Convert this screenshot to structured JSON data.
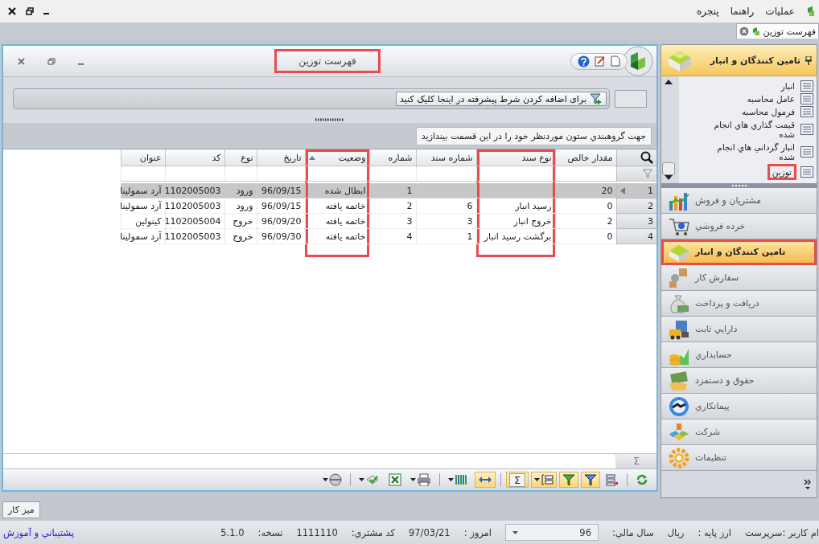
{
  "menu_bar": {
    "items": [
      "عملیات",
      "راهنما",
      "پنجره"
    ]
  },
  "tabs": [
    {
      "label": "فهرست توزین",
      "selected": true
    }
  ],
  "document": {
    "title": "فهرست توزین",
    "title_highlighted": true,
    "filter_prompt": "برای اضافه کردن شرط پیشرفته در اینجا کلیک کنید",
    "group_hint": "جهت گروهبندي ستون موردنظر خود را در این قسمت بيندازيد",
    "table": {
      "columns": [
        {
          "label": "مقدار خالص",
          "highlighted": false,
          "sorted": false
        },
        {
          "label": "نوع سند",
          "highlighted": true,
          "sorted": false
        },
        {
          "label": "شماره سند",
          "highlighted": false,
          "sorted": false
        },
        {
          "label": "شماره",
          "highlighted": false,
          "sorted": false
        },
        {
          "label": "وضعیت",
          "highlighted": true,
          "sorted": true
        },
        {
          "label": "تاریخ",
          "highlighted": false,
          "sorted": false
        },
        {
          "label": "نوع",
          "highlighted": false,
          "sorted": false
        },
        {
          "label": "کد",
          "highlighted": false,
          "sorted": false
        },
        {
          "label": "عنوان",
          "highlighted": false,
          "sorted": false
        }
      ],
      "rows": [
        {
          "number": "1",
          "selected": true,
          "cells": [
            "20",
            "",
            "",
            "1",
            "ابطال شده",
            "96/09/15",
            "ورود",
            "1102005003",
            "آرد سمولينا"
          ]
        },
        {
          "number": "2",
          "selected": false,
          "cells": [
            "0",
            "رسید انبار",
            "6",
            "2",
            "خاتمه یافته",
            "96/09/15",
            "ورود",
            "1102005003",
            "آرد سمولينا"
          ]
        },
        {
          "number": "3",
          "selected": false,
          "cells": [
            "2",
            "خروج انبار",
            "3",
            "3",
            "خاتمه یافته",
            "96/09/20",
            "خروج",
            "1102005004",
            "کینولین"
          ]
        },
        {
          "number": "4",
          "selected": false,
          "cells": [
            "0",
            "برگشت رسید انبار",
            "1",
            "4",
            "خاتمه یافته",
            "96/09/30",
            "خروج",
            "1102005003",
            "آرد سمولينا"
          ]
        }
      ]
    },
    "summary_symbol": "Σ",
    "toolbar": [
      {
        "kind": "refresh",
        "on": false,
        "dropdown": false
      },
      {
        "kind": "separator"
      },
      {
        "kind": "column-chooser",
        "on": false,
        "dropdown": false
      },
      {
        "kind": "filter",
        "on": true,
        "dropdown": false
      },
      {
        "kind": "filter-green",
        "on": true,
        "dropdown": false
      },
      {
        "kind": "group",
        "on": true,
        "dropdown": true
      },
      {
        "kind": "sum",
        "on": true,
        "dropdown": false,
        "label": "Σ"
      },
      {
        "kind": "separator"
      },
      {
        "kind": "fit",
        "on": true,
        "dropdown": false
      },
      {
        "kind": "bars",
        "on": false,
        "dropdown": true
      },
      {
        "kind": "separator"
      },
      {
        "kind": "print",
        "on": false,
        "dropdown": true
      },
      {
        "kind": "excel",
        "on": false,
        "dropdown": false
      },
      {
        "kind": "export",
        "on": false,
        "dropdown": true
      },
      {
        "kind": "separator"
      },
      {
        "kind": "globe",
        "on": false,
        "dropdown": true
      }
    ]
  },
  "navigation": {
    "header": "تامین کنندگان و انبار",
    "items": [
      {
        "label": "انبار",
        "selected": false,
        "highlighted": false
      },
      {
        "label": "عامل محاسبه",
        "selected": false,
        "highlighted": false
      },
      {
        "label": "فرمول محاسبه",
        "selected": false,
        "highlighted": false
      },
      {
        "label": "قیمت گذاري هاي انجام شده",
        "selected": false,
        "highlighted": false
      },
      {
        "label": "انبار گرداني هاي انجام شده",
        "selected": false,
        "highlighted": false
      },
      {
        "label": "توزین",
        "selected": false,
        "highlighted": true
      }
    ],
    "modules": [
      {
        "label": "مشتريان و فروش",
        "selected": false,
        "highlighted": false
      },
      {
        "label": "خرده فروشي",
        "selected": false,
        "highlighted": false
      },
      {
        "label": "تامین کنندگان و انبار",
        "selected": true,
        "highlighted": true
      },
      {
        "label": "سفارش کار",
        "selected": false,
        "highlighted": false
      },
      {
        "label": "دریافت و پرداخت",
        "selected": false,
        "highlighted": false
      },
      {
        "label": "دارايي ثابت",
        "selected": false,
        "highlighted": false
      },
      {
        "label": "حسابداري",
        "selected": false,
        "highlighted": false
      },
      {
        "label": "حقوق و دستمزد",
        "selected": false,
        "highlighted": false
      },
      {
        "label": "پيمانكاري",
        "selected": false,
        "highlighted": false
      },
      {
        "label": "شرکت",
        "selected": false,
        "highlighted": false
      },
      {
        "label": "تنظیمات",
        "selected": false,
        "highlighted": false
      }
    ]
  },
  "desk_button": "میز کار",
  "status_bar": [
    {
      "kind": "label",
      "text": "ام کاربر :سرپرست"
    },
    {
      "kind": "label",
      "text": "ارز پایه :"
    },
    {
      "kind": "value",
      "text": "ريال"
    },
    {
      "kind": "label",
      "text": "سال مالي:"
    },
    {
      "kind": "field",
      "text": "96"
    },
    {
      "kind": "label",
      "text": "امروز :"
    },
    {
      "kind": "value",
      "text": "97/03/21"
    },
    {
      "kind": "label",
      "text": "کد مشتري:"
    },
    {
      "kind": "value",
      "text": "1111110"
    },
    {
      "kind": "label",
      "text": "نسخه:"
    },
    {
      "kind": "value",
      "text": "5.1.0"
    },
    {
      "kind": "link",
      "text": "پشتيباني و آموزش"
    }
  ]
}
